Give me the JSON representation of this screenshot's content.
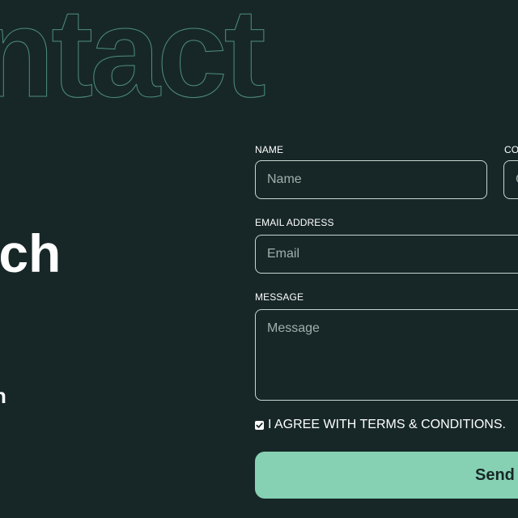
{
  "hero": {
    "outline_title": "ntact",
    "heading": "uch",
    "fragment": "n"
  },
  "form": {
    "name_label": "NAME",
    "name_placeholder": "Name",
    "second_label": "CO",
    "second_placeholder": "C",
    "email_label": "EMAIL ADDRESS",
    "email_placeholder": "Email",
    "message_label": "MESSAGE",
    "message_placeholder": "Message",
    "agree_label": "I AGREE WITH TERMS & CONDITIONS.",
    "agree_checked": true,
    "send_label": "Send"
  },
  "colors": {
    "background": "#172727",
    "accent": "#86d1b3",
    "outline": "#4f8f7e"
  }
}
